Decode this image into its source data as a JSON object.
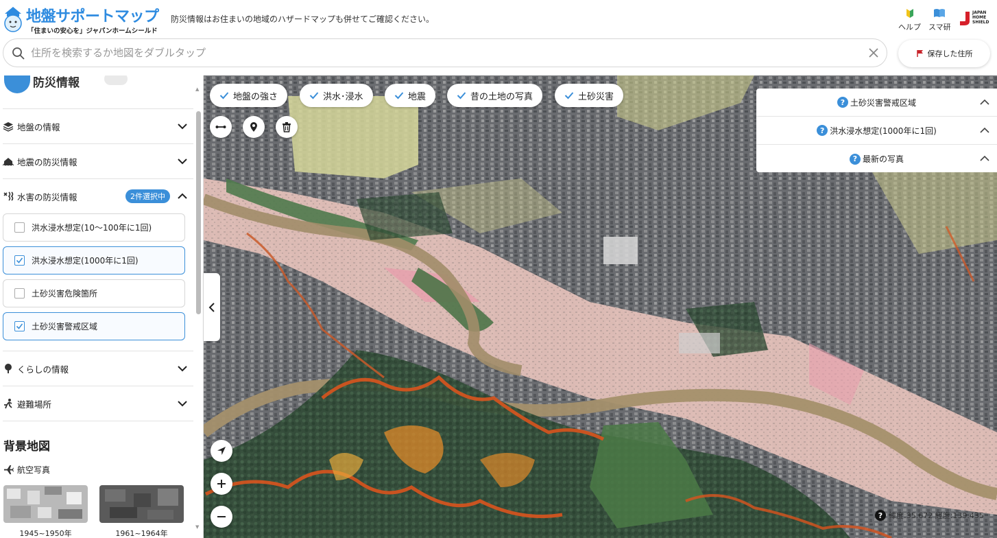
{
  "header": {
    "app_title": "地盤サポートマップ",
    "tagline": "「住まいの安心を」ジャパンホームシールド",
    "notice": "防災情報はお住まいの地域のハザードマップも併せてご確認ください。",
    "links": [
      {
        "label": "ヘルプ",
        "icon": "beginner-leaf-icon"
      },
      {
        "label": "スマ研",
        "icon": "book-icon"
      }
    ],
    "company_logo_text": "JAPAN HOME SHIELD",
    "search_placeholder": "住所を検索するか地図をダブルタップ",
    "search_value": "",
    "saved_button_label": "保存した住所"
  },
  "sidebar": {
    "section_title": "防災情報",
    "categories": [
      {
        "label": "地盤の情報",
        "icon": "layers-icon",
        "expanded": false
      },
      {
        "label": "地震の防災情報",
        "icon": "house-quake-icon",
        "expanded": false
      },
      {
        "label": "水害の防災情報",
        "icon": "flood-icon",
        "expanded": true,
        "badge": "2件選択中"
      },
      {
        "label": "くらしの情報",
        "icon": "tree-icon",
        "expanded": false
      },
      {
        "label": "避難場所",
        "icon": "evacuation-icon",
        "expanded": false
      }
    ],
    "water_options": [
      {
        "label": "洪水浸水想定(10〜100年に1回)",
        "checked": false
      },
      {
        "label": "洪水浸水想定(1000年に1回)",
        "checked": true
      },
      {
        "label": "土砂災害危険箇所",
        "checked": false
      },
      {
        "label": "土砂災害警戒区域",
        "checked": true
      }
    ],
    "background_title": "背景地図",
    "aerial_label": "航空写真",
    "aerial_thumbs": [
      {
        "label": "1945~1950年"
      },
      {
        "label": "1961~1964年"
      }
    ]
  },
  "map": {
    "chips": [
      "地盤の強さ",
      "洪水･浸水",
      "地震",
      "昔の土地の写真",
      "土砂災害"
    ],
    "tools": [
      "measure-icon",
      "pin-icon",
      "trash-icon"
    ],
    "legend": [
      "土砂災害警戒区域",
      "洪水浸水想定(1000年に1回)",
      "最新の写真"
    ],
    "coords_text": "緯度:35.672 経度:139.435",
    "colors": {
      "accent": "#3b8fd9",
      "flood_pink": "#e9b9b9",
      "river": "#a5906a",
      "warning_orange": "#d9541e",
      "yellow_zone": "#d9d98a"
    }
  }
}
